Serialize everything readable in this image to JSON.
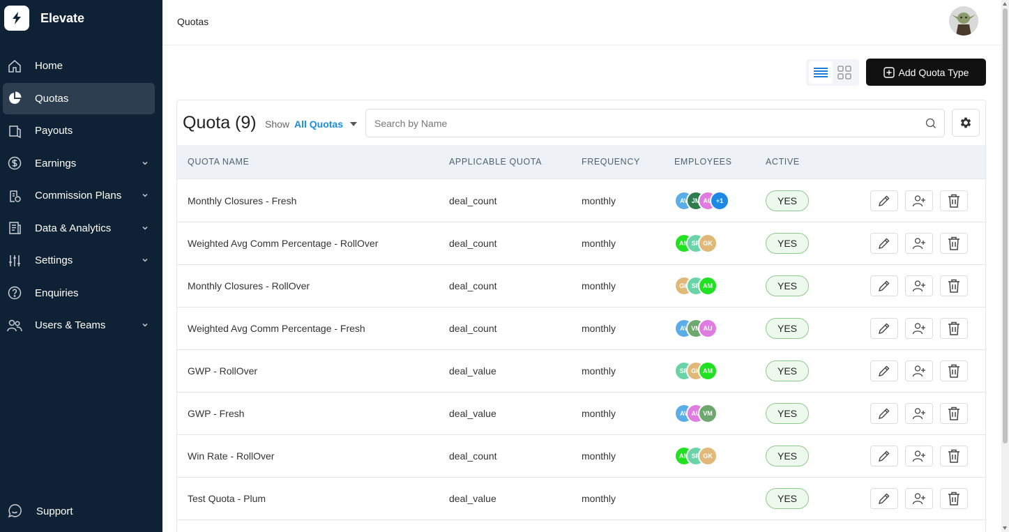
{
  "app": {
    "name": "Elevate",
    "colors": {
      "sidebar": "#0f2235",
      "active_nav": "#2c3e50",
      "accent": "#1a8ee0",
      "primary_button": "#111111"
    }
  },
  "sidebar": {
    "items": [
      {
        "label": "Home",
        "icon": "home-icon",
        "has_chevron": false,
        "active": false
      },
      {
        "label": "Quotas",
        "icon": "pie-chart-icon",
        "has_chevron": false,
        "active": true
      },
      {
        "label": "Payouts",
        "icon": "payouts-icon",
        "has_chevron": false,
        "active": false
      },
      {
        "label": "Earnings",
        "icon": "dollar-icon",
        "has_chevron": true,
        "active": false
      },
      {
        "label": "Commission Plans",
        "icon": "clipboard-icon",
        "has_chevron": true,
        "active": false
      },
      {
        "label": "Data & Analytics",
        "icon": "analytics-icon",
        "has_chevron": true,
        "active": false
      },
      {
        "label": "Settings",
        "icon": "sliders-icon",
        "has_chevron": true,
        "active": false
      },
      {
        "label": "Enquiries",
        "icon": "help-icon",
        "has_chevron": false,
        "active": false
      },
      {
        "label": "Users & Teams",
        "icon": "users-icon",
        "has_chevron": true,
        "active": false
      }
    ],
    "support_label": "Support"
  },
  "header": {
    "title": "Quotas"
  },
  "toolbar": {
    "add_label": "Add Quota Type",
    "view_mode": "list"
  },
  "card": {
    "title": "Quota (9)",
    "show_label": "Show",
    "filter_value": "All Quotas",
    "search_placeholder": "Search by Name"
  },
  "table": {
    "columns": [
      "QUOTA NAME",
      "APPLICABLE QUOTA",
      "FREQUENCY",
      "EMPLOYEES",
      "ACTIVE"
    ],
    "rows": [
      {
        "name": "Monthly Closures - Fresh",
        "applicable": "deal_count",
        "frequency": "monthly",
        "active": "YES",
        "employees": [
          {
            "i": "AV",
            "c": "#5aaee8"
          },
          {
            "i": "JM",
            "c": "#2e7d4f"
          },
          {
            "i": "AU",
            "c": "#e07be0"
          },
          {
            "i": "+1",
            "c": "#1e88e5"
          }
        ]
      },
      {
        "name": "Weighted Avg Comm Percentage - RollOver",
        "applicable": "deal_count",
        "frequency": "monthly",
        "active": "YES",
        "employees": [
          {
            "i": "AM",
            "c": "#22e022"
          },
          {
            "i": "SR",
            "c": "#6ad4a8"
          },
          {
            "i": "GK",
            "c": "#e0b878"
          }
        ]
      },
      {
        "name": "Monthly Closures - RollOver",
        "applicable": "deal_count",
        "frequency": "monthly",
        "active": "YES",
        "employees": [
          {
            "i": "GK",
            "c": "#e0b878"
          },
          {
            "i": "SR",
            "c": "#6ad4a8"
          },
          {
            "i": "AM",
            "c": "#22e022"
          }
        ]
      },
      {
        "name": "Weighted Avg Comm Percentage - Fresh",
        "applicable": "deal_count",
        "frequency": "monthly",
        "active": "YES",
        "employees": [
          {
            "i": "AV",
            "c": "#5aaee8"
          },
          {
            "i": "VM",
            "c": "#6fa86f"
          },
          {
            "i": "AU",
            "c": "#e07be0"
          }
        ]
      },
      {
        "name": "GWP - RollOver",
        "applicable": "deal_value",
        "frequency": "monthly",
        "active": "YES",
        "employees": [
          {
            "i": "SR",
            "c": "#6ad4a8"
          },
          {
            "i": "GK",
            "c": "#e0b878"
          },
          {
            "i": "AM",
            "c": "#22e022"
          }
        ]
      },
      {
        "name": "GWP - Fresh",
        "applicable": "deal_value",
        "frequency": "monthly",
        "active": "YES",
        "employees": [
          {
            "i": "AV",
            "c": "#5aaee8"
          },
          {
            "i": "AU",
            "c": "#e07be0"
          },
          {
            "i": "VM",
            "c": "#6fa86f"
          }
        ]
      },
      {
        "name": "Win Rate - RollOver",
        "applicable": "deal_count",
        "frequency": "monthly",
        "active": "YES",
        "employees": [
          {
            "i": "AM",
            "c": "#22e022"
          },
          {
            "i": "SR",
            "c": "#6ad4a8"
          },
          {
            "i": "GK",
            "c": "#e0b878"
          }
        ]
      },
      {
        "name": "Test Quota - Plum",
        "applicable": "deal_value",
        "frequency": "monthly",
        "active": "YES",
        "employees": []
      }
    ]
  }
}
